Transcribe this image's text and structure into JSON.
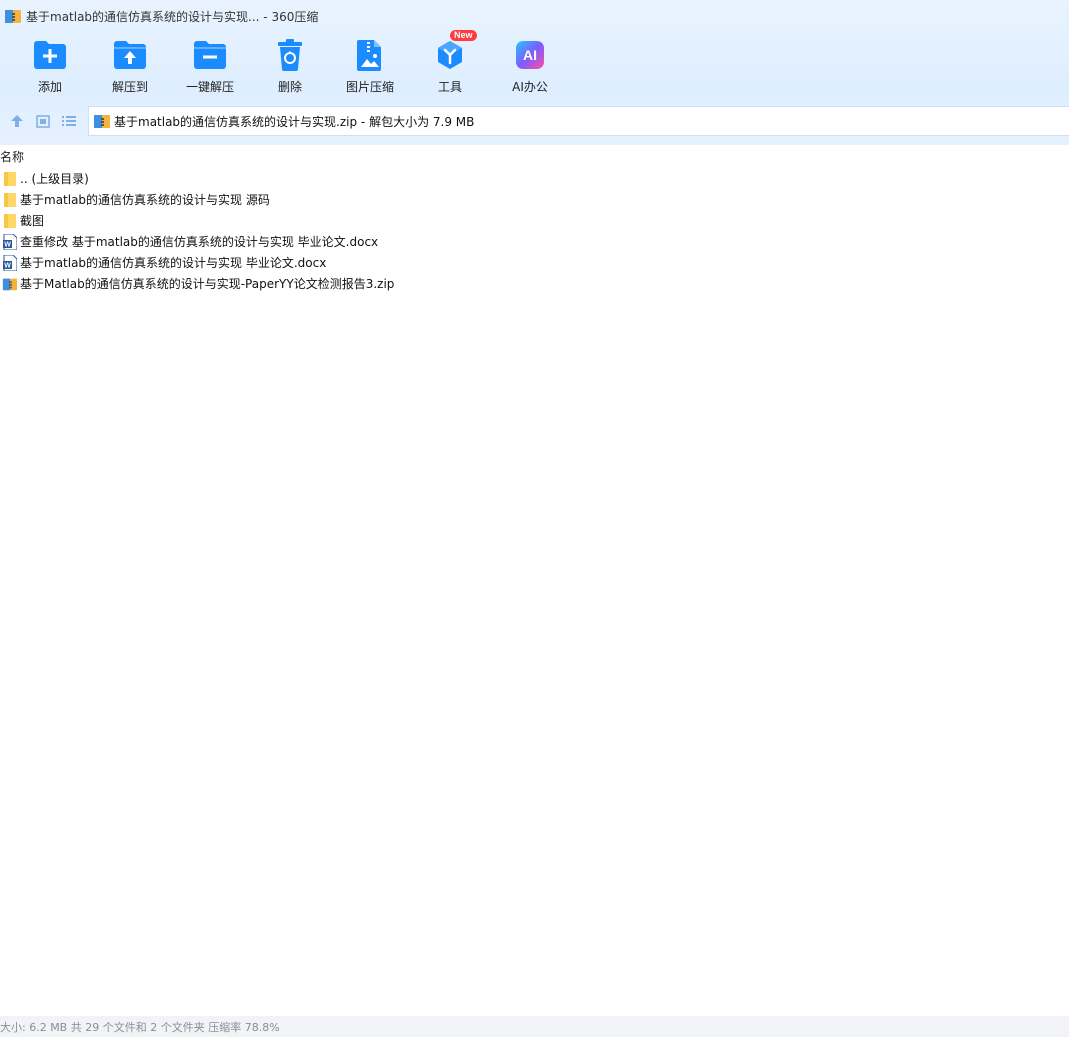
{
  "window": {
    "title": "基于matlab的通信仿真系统的设计与实现... - 360压缩"
  },
  "toolbar": {
    "items": [
      {
        "label": "添加",
        "icon": "add-icon"
      },
      {
        "label": "解压到",
        "icon": "extract-to-icon"
      },
      {
        "label": "一键解压",
        "icon": "one-click-extract-icon"
      },
      {
        "label": "删除",
        "icon": "delete-icon"
      },
      {
        "label": "图片压缩",
        "icon": "image-compress-icon"
      },
      {
        "label": "工具",
        "icon": "tools-icon",
        "badge": "New"
      },
      {
        "label": "AI办公",
        "icon": "ai-office-icon",
        "icon_text": "AI"
      }
    ]
  },
  "address": {
    "path": "基于matlab的通信仿真系统的设计与实现.zip - 解包大小为 7.9 MB"
  },
  "list": {
    "column_name": "名称",
    "rows": [
      {
        "name": ".. (上级目录)",
        "type": "folder"
      },
      {
        "name": "基于matlab的通信仿真系统的设计与实现 源码",
        "type": "folder"
      },
      {
        "name": "截图",
        "type": "folder"
      },
      {
        "name": "查重修改 基于matlab的通信仿真系统的设计与实现 毕业论文.docx",
        "type": "docx"
      },
      {
        "name": "基于matlab的通信仿真系统的设计与实现 毕业论文.docx",
        "type": "docx"
      },
      {
        "name": "基于Matlab的通信仿真系统的设计与实现-PaperYY论文检测报告3.zip",
        "type": "zip"
      }
    ]
  },
  "status": {
    "text": "大小: 6.2 MB 共 29 个文件和 2 个文件夹 压缩率 78.8%"
  },
  "colors": {
    "accent": "#1a8cff",
    "folder": "#ffd768",
    "word": "#2b579a",
    "badge": "#ff3b3b"
  }
}
